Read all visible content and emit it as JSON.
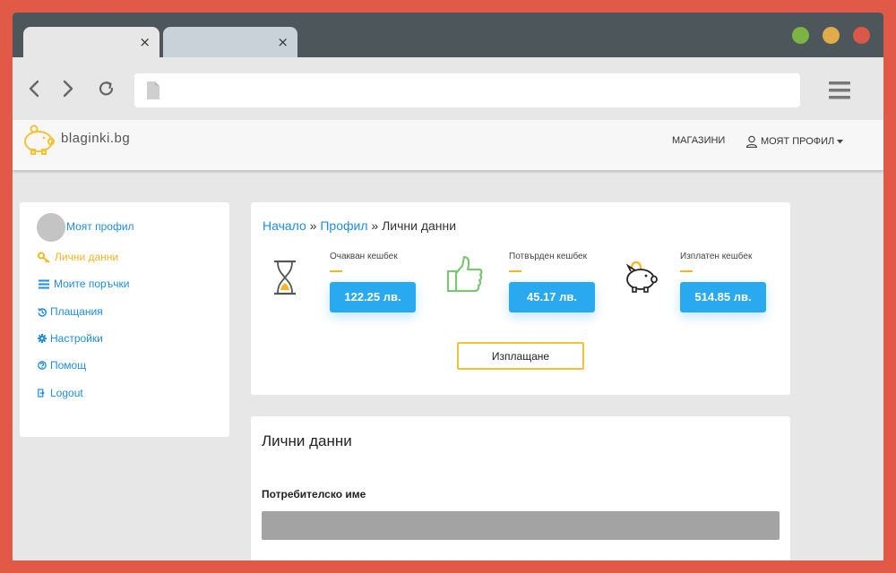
{
  "browser": {
    "tabs": [
      {
        "close_glyph": "×"
      },
      {
        "close_glyph": "×"
      }
    ],
    "window_controls": [
      "green",
      "yellow",
      "red"
    ]
  },
  "site": {
    "logo_text": "blaginki.bg",
    "nav": {
      "shops": "МАГАЗИНИ",
      "profile": "МОЯТ ПРОФИЛ"
    }
  },
  "sidebar": {
    "title": "Моят профил",
    "items": [
      {
        "label": "Лични данни",
        "icon": "key-icon",
        "active": true
      },
      {
        "label": "Моите поръчки",
        "icon": "list-icon",
        "active": false
      },
      {
        "label": "Плащания",
        "icon": "history-icon",
        "active": false
      },
      {
        "label": "Настройки",
        "icon": "gear-icon",
        "active": false
      },
      {
        "label": "Помощ",
        "icon": "question-icon",
        "active": false
      },
      {
        "label": "Logout",
        "icon": "logout-icon",
        "active": false
      }
    ]
  },
  "breadcrumb": {
    "home": "Начало",
    "profile": "Профил",
    "separator": "»",
    "current": "Лични данни"
  },
  "stats": [
    {
      "label": "Очакван кешбек",
      "value": "122.25 лв.",
      "icon": "hourglass-icon"
    },
    {
      "label": "Потвърден кешбек",
      "value": "45.17 лв.",
      "icon": "thumbs-up-icon"
    },
    {
      "label": "Изплатен кешбек",
      "value": "514.85 лв.",
      "icon": "piggy-bank-icon"
    }
  ],
  "payout_button": "Изплащане",
  "personal": {
    "title": "Лични данни",
    "username_label": "Потребителско име",
    "username_value": ""
  },
  "colors": {
    "accent_blue": "#29a9ef",
    "accent_yellow": "#f4b623",
    "frame": "#e05a47",
    "titlebar": "#4d575b"
  }
}
